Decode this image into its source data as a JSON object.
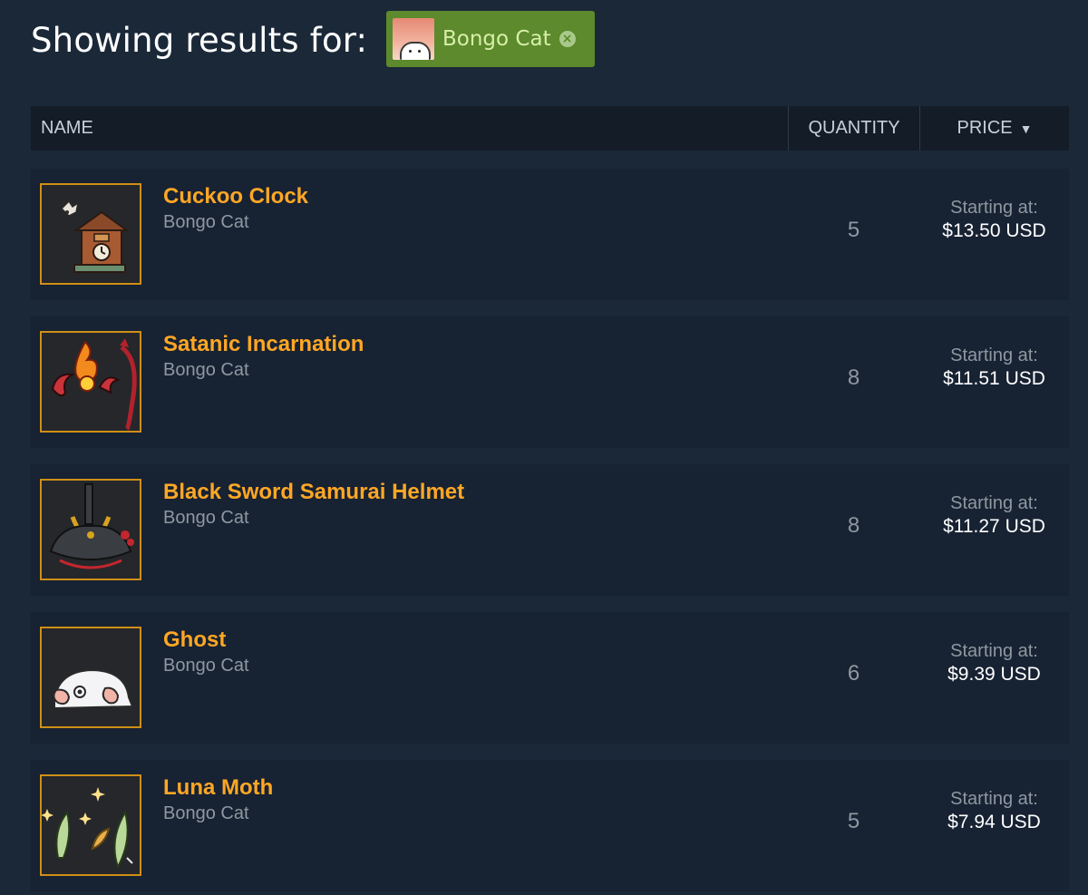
{
  "header": {
    "title": "Showing results for:",
    "filter_tag": {
      "label": "Bongo Cat",
      "icon": "close-circle-icon",
      "color": "#5c8a2c"
    }
  },
  "table": {
    "columns": {
      "name": "NAME",
      "quantity": "QUANTITY",
      "price": "PRICE",
      "price_sort_icon": "▼"
    },
    "price_prefix_label": "Starting at:",
    "rows": [
      {
        "name": "Cuckoo Clock",
        "game": "Bongo Cat",
        "quantity": "5",
        "price": "$13.50 USD",
        "icon": "cuckoo-clock-icon"
      },
      {
        "name": "Satanic Incarnation",
        "game": "Bongo Cat",
        "quantity": "8",
        "price": "$11.51 USD",
        "icon": "satanic-incarnation-icon"
      },
      {
        "name": "Black Sword Samurai Helmet",
        "game": "Bongo Cat",
        "quantity": "8",
        "price": "$11.27 USD",
        "icon": "samurai-helmet-icon"
      },
      {
        "name": "Ghost",
        "game": "Bongo Cat",
        "quantity": "6",
        "price": "$9.39 USD",
        "icon": "ghost-icon"
      },
      {
        "name": "Luna Moth",
        "game": "Bongo Cat",
        "quantity": "5",
        "price": "$7.94 USD",
        "icon": "luna-moth-icon"
      }
    ]
  },
  "colors": {
    "background": "#1b2838",
    "row_background": "#172233",
    "header_background": "#141c27",
    "item_name": "#ffa724",
    "item_border": "#cf8f16",
    "muted_text": "#8f98a0"
  }
}
